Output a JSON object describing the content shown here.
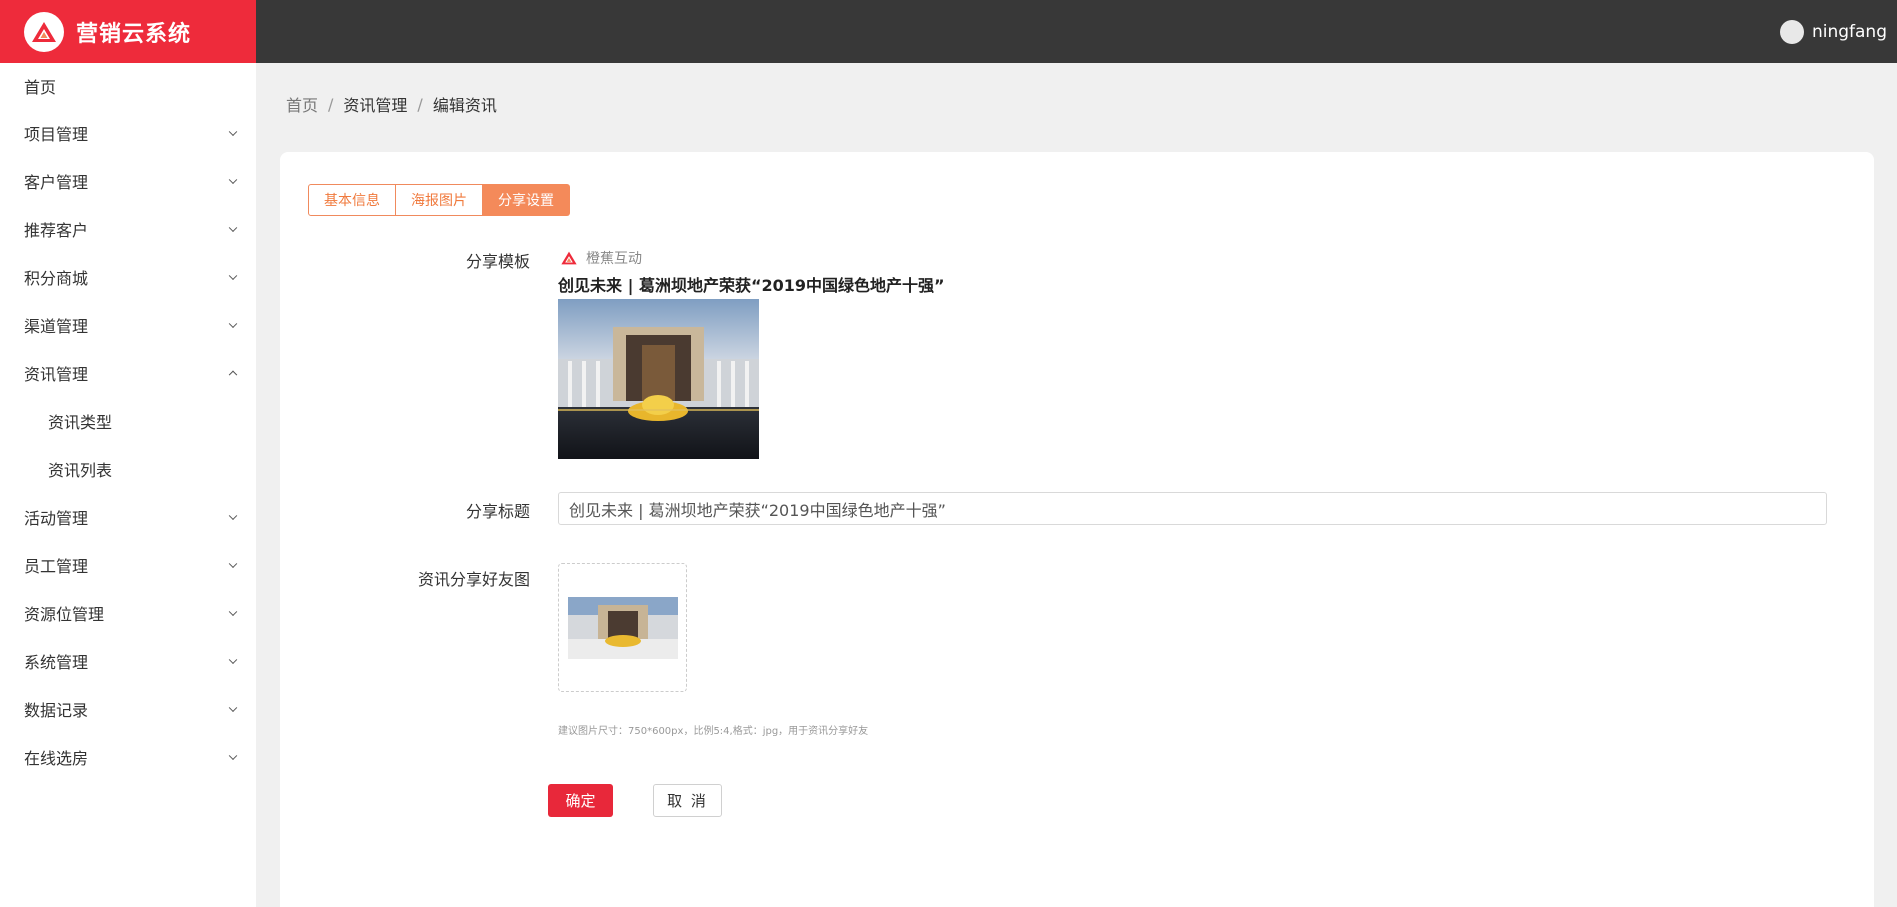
{
  "app": {
    "title": "营销云系统"
  },
  "header": {
    "username": "ningfang"
  },
  "sidebar": {
    "items": [
      {
        "label": "首页"
      },
      {
        "label": "项目管理"
      },
      {
        "label": "客户管理"
      },
      {
        "label": "推荐客户"
      },
      {
        "label": "积分商城"
      },
      {
        "label": "渠道管理"
      },
      {
        "label": "资讯管理"
      },
      {
        "label": "活动管理"
      },
      {
        "label": "员工管理"
      },
      {
        "label": "资源位管理"
      },
      {
        "label": "系统管理"
      },
      {
        "label": "数据记录"
      },
      {
        "label": "在线选房"
      }
    ],
    "news_sub": [
      {
        "label": "资讯类型"
      },
      {
        "label": "资讯列表"
      }
    ]
  },
  "breadcrumb": {
    "home": "首页",
    "section": "资讯管理",
    "current": "编辑资讯",
    "sep": "/"
  },
  "tabs": [
    {
      "label": "基本信息"
    },
    {
      "label": "海报图片"
    },
    {
      "label": "分享设置"
    }
  ],
  "form": {
    "template_label": "分享模板",
    "template_brand": "橙蕉互动",
    "template_title": "创见未来 | 葛洲坝地产荣获“2019中国绿色地产十强”",
    "title_label": "分享标题",
    "title_value": "创见未来 | 葛洲坝地产荣获“2019中国绿色地产十强”",
    "friend_image_label": "资讯分享好友图",
    "hint": "建议图片尺寸：750*600px，比例5:4,格式：jpg，用于资讯分享好友"
  },
  "buttons": {
    "ok": "确定",
    "cancel": "取 消"
  },
  "colors": {
    "brand": "#ee2b3b",
    "topbar": "#383838",
    "tab_accent": "#f48a5a"
  }
}
